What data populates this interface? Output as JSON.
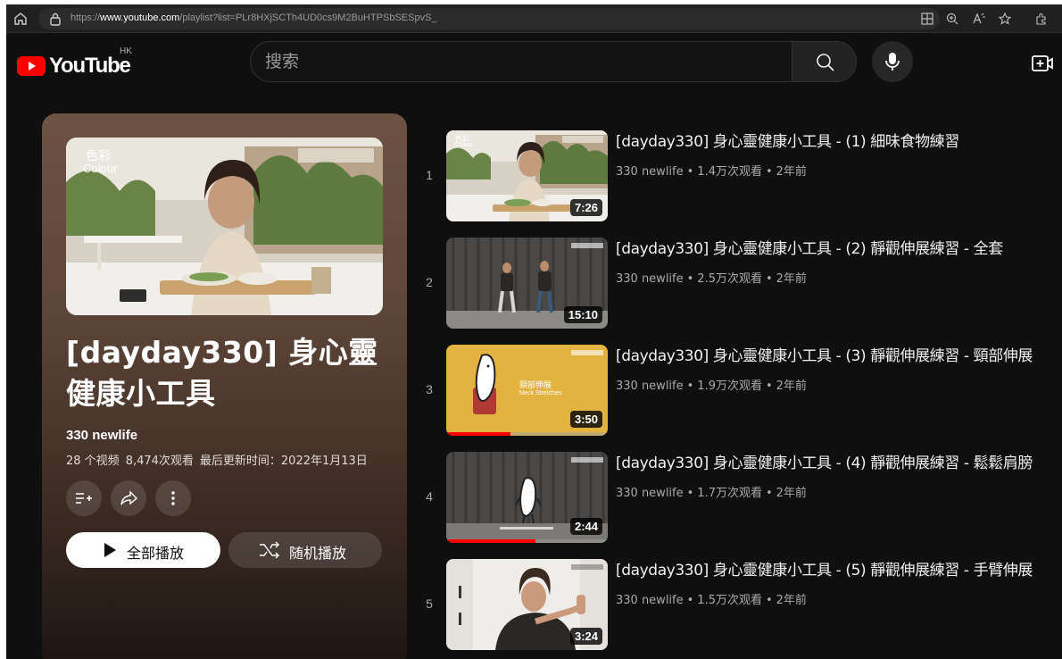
{
  "browser": {
    "url_prefix": "https://",
    "url_domain": "www.youtube.com",
    "url_path": "/playlist?list=PLr8HXjSCTh4UD0cs9M2BuHTPSbSESpvS_"
  },
  "header": {
    "logo_text": "YouTube",
    "region": "HK",
    "search_placeholder": "搜索"
  },
  "playlist": {
    "title": "[dayday330] 身心靈健康小工具",
    "channel": "330 newlife",
    "video_count": "28 个视频",
    "views": "8,474次观看",
    "updated": "最后更新时间：2022年1月13日",
    "play_all_label": "全部播放",
    "shuffle_label": "随机播放",
    "thumb_label_cn": "色彩",
    "thumb_label_en": "Colour"
  },
  "videos": [
    {
      "index": "1",
      "title": "[dayday330] 身心靈健康小工具 - (1) 細味食物練習",
      "channel": "330 newlife",
      "views": "1.4万次观看",
      "age": "2年前",
      "duration": "7:26",
      "progress": 0,
      "thumb_label_cn": "色彩",
      "thumb_label_en": "Colour"
    },
    {
      "index": "2",
      "title": "[dayday330] 身心靈健康小工具 - (2) 靜觀伸展練習 - 全套",
      "channel": "330 newlife",
      "views": "2.5万次观看",
      "age": "2年前",
      "duration": "15:10",
      "progress": 0
    },
    {
      "index": "3",
      "title": "[dayday330] 身心靈健康小工具 - (3) 靜觀伸展練習 - 頸部伸展",
      "channel": "330 newlife",
      "views": "1.9万次观看",
      "age": "2年前",
      "duration": "3:50",
      "progress": 0.4,
      "thumb_label_cn": "頸部伸展",
      "thumb_label_en": "Neck Stretches"
    },
    {
      "index": "4",
      "title": "[dayday330] 身心靈健康小工具 - (4) 靜觀伸展練習 - 鬆鬆肩膀",
      "channel": "330 newlife",
      "views": "1.7万次观看",
      "age": "2年前",
      "duration": "2:44",
      "progress": 0.55
    },
    {
      "index": "5",
      "title": "[dayday330] 身心靈健康小工具 - (5) 靜觀伸展練習 - 手臂伸展",
      "channel": "330 newlife",
      "views": "1.5万次观看",
      "age": "2年前",
      "duration": "3:24",
      "progress": 0
    }
  ],
  "colors": {
    "background": "#0f0f0f",
    "brand_red": "#ff0000",
    "card_tint": "#6d5244"
  }
}
